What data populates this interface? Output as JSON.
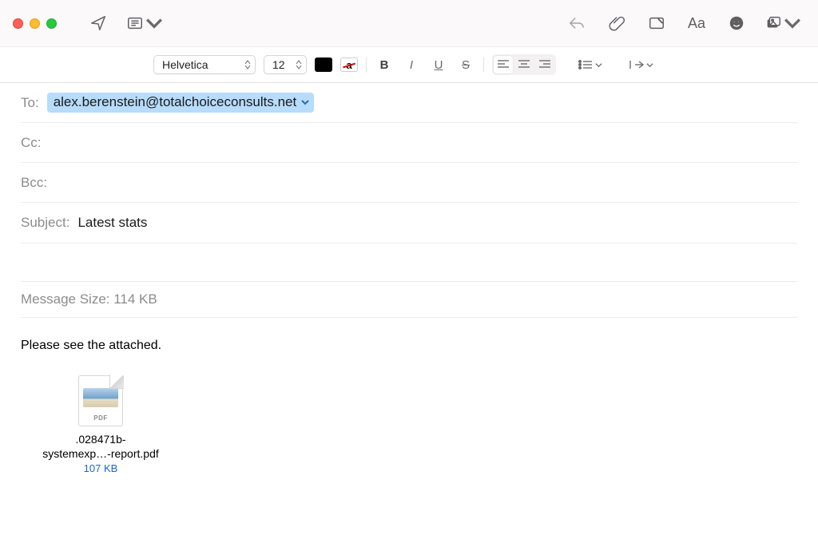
{
  "format": {
    "font": "Helvetica",
    "size": "12",
    "bold_label": "B",
    "italic_label": "I",
    "underline_label": "U",
    "strike_label": "S",
    "striketext": "a"
  },
  "fields": {
    "to_label": "To:",
    "to_recipient": "alex.berenstein@totalchoiceconsults.net",
    "cc_label": "Cc:",
    "bcc_label": "Bcc:",
    "subject_label": "Subject:",
    "subject_value": "Latest stats"
  },
  "meta": {
    "message_size_label": "Message Size: 114 KB"
  },
  "body": {
    "text": "Please see the attached."
  },
  "attachment": {
    "badge": "PDF",
    "name_line1": ".028471b-",
    "name_line2": "systemexp…-report.pdf",
    "size": "107 KB"
  }
}
